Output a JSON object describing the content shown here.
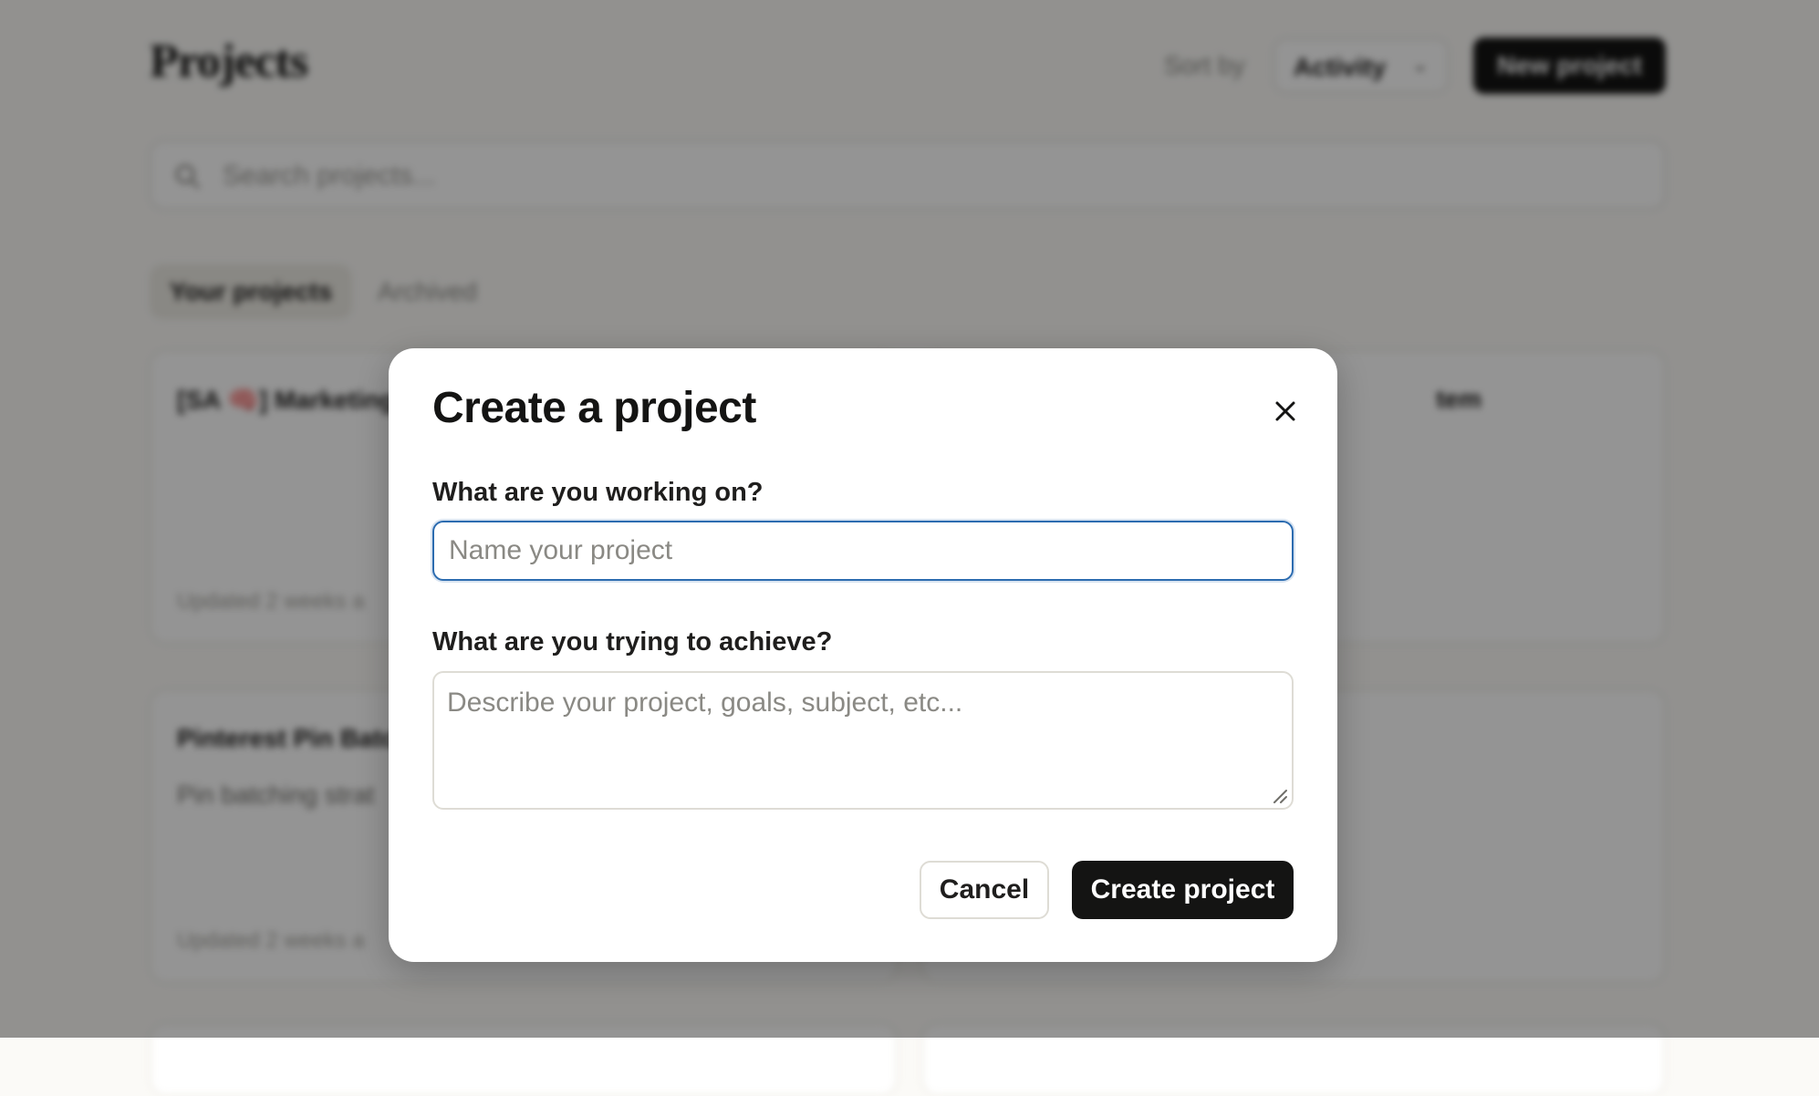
{
  "background": {
    "page_title": "Projects",
    "sort_label": "Sort by",
    "sort_value": "Activity",
    "new_project_label": "New project",
    "search_placeholder": "Search projects...",
    "tabs": [
      {
        "label": "Your projects",
        "active": true
      },
      {
        "label": "Archived",
        "active": false
      }
    ],
    "cards": [
      {
        "title": "[SA 🧠] Marketing",
        "description": "",
        "meta": "Updated 2 weeks a"
      },
      {
        "title": "tem",
        "description": "",
        "meta": ""
      },
      {
        "title": "Pinterest Pin Batc",
        "description": "Pin batching strat",
        "meta": "Updated 2 weeks a"
      },
      {
        "title": "",
        "description": "",
        "meta": ""
      }
    ]
  },
  "modal": {
    "title": "Create a project",
    "name_label": "What are you working on?",
    "name_placeholder": "Name your project",
    "name_value": "",
    "description_label": "What are you trying to achieve?",
    "description_placeholder": "Describe your project, goals, subject, etc...",
    "description_value": "",
    "cancel_label": "Cancel",
    "create_label": "Create project"
  },
  "colors": {
    "primary_button": "#141413",
    "focus_ring": "#2c6cb0",
    "overlay": "rgba(0,0,0,0.42)"
  }
}
